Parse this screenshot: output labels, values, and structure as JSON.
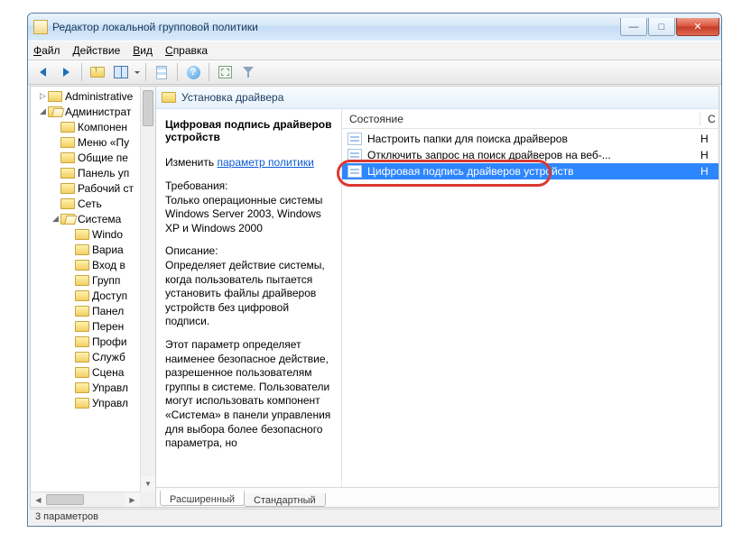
{
  "window": {
    "title": "Редактор локальной групповой политики"
  },
  "menubar": {
    "file": "Файл",
    "action": "Действие",
    "view": "Вид",
    "help": "Справка"
  },
  "tree": {
    "items": [
      {
        "indent": "ind1",
        "twist": "▷",
        "open": false,
        "label": "Administrative"
      },
      {
        "indent": "ind1",
        "twist": "◢",
        "open": true,
        "label": "Администрат"
      },
      {
        "indent": "ind2",
        "twist": "",
        "open": false,
        "label": "Компонен"
      },
      {
        "indent": "ind2",
        "twist": "",
        "open": false,
        "label": "Меню «Пу"
      },
      {
        "indent": "ind2",
        "twist": "",
        "open": false,
        "label": "Общие пе"
      },
      {
        "indent": "ind2",
        "twist": "",
        "open": false,
        "label": "Панель уп"
      },
      {
        "indent": "ind2",
        "twist": "",
        "open": false,
        "label": "Рабочий ст"
      },
      {
        "indent": "ind2",
        "twist": "",
        "open": false,
        "label": "Сеть"
      },
      {
        "indent": "ind2",
        "twist": "◢",
        "open": true,
        "label": "Система"
      },
      {
        "indent": "ind3",
        "twist": "",
        "open": false,
        "label": "Windo"
      },
      {
        "indent": "ind3",
        "twist": "",
        "open": false,
        "label": "Вариа"
      },
      {
        "indent": "ind3",
        "twist": "",
        "open": false,
        "label": "Вход в"
      },
      {
        "indent": "ind3",
        "twist": "",
        "open": false,
        "label": "Групп"
      },
      {
        "indent": "ind3",
        "twist": "",
        "open": false,
        "label": "Доступ"
      },
      {
        "indent": "ind3",
        "twist": "",
        "open": false,
        "label": "Панел"
      },
      {
        "indent": "ind3",
        "twist": "",
        "open": false,
        "label": "Перен"
      },
      {
        "indent": "ind3",
        "twist": "",
        "open": false,
        "label": "Профи"
      },
      {
        "indent": "ind3",
        "twist": "",
        "open": false,
        "label": "Служб"
      },
      {
        "indent": "ind3",
        "twist": "",
        "open": false,
        "label": "Сцена"
      },
      {
        "indent": "ind3",
        "twist": "",
        "open": false,
        "label": "Управл"
      },
      {
        "indent": "ind3",
        "twist": "",
        "open": false,
        "label": "Управл"
      }
    ]
  },
  "location": {
    "label": "Установка драйвера"
  },
  "desc": {
    "title": "Цифровая подпись драйверов устройств",
    "edit_label": "Изменить",
    "edit_link": "параметр политики",
    "req_lbl": "Требования:",
    "req_txt": "Только операционные системы Windows Server 2003, Windows XP и Windows 2000",
    "dsc_lbl": "Описание:",
    "dsc_txt": "Определяет действие системы, когда пользователь пытается установить файлы драйверов устройств без цифровой подписи.",
    "dsc_txt2": "Этот параметр определяет наименее безопасное действие, разрешенное пользователям группы в системе. Пользователи могут использовать компонент «Система» в панели управления для выбора более безопасного параметра, но"
  },
  "settings": {
    "header_state": "Состояние",
    "header_c": "С",
    "rows": [
      {
        "label": "Настроить папки для поиска драйверов",
        "val": "Н",
        "sel": false
      },
      {
        "label": "Отключить запрос на поиск драйверов на веб-...",
        "val": "Н",
        "sel": false
      },
      {
        "label": "Цифровая подпись драйверов устройств",
        "val": "Н",
        "sel": true
      }
    ]
  },
  "tabs": {
    "ext": "Расширенный",
    "std": "Стандартный"
  },
  "status": {
    "text": "3 параметров"
  }
}
